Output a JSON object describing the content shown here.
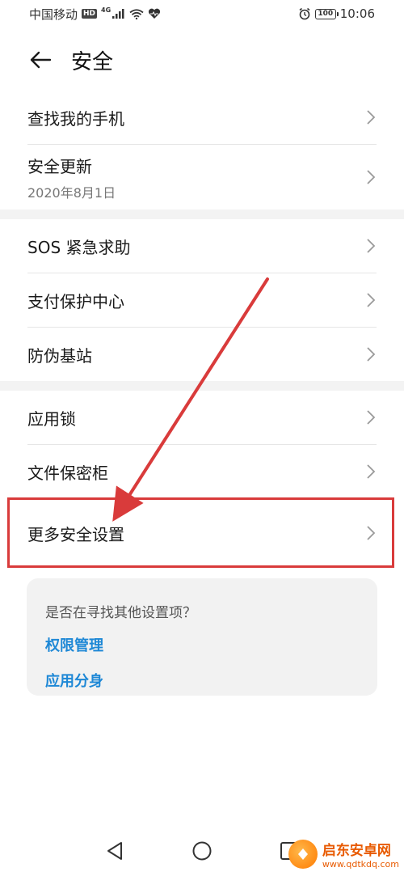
{
  "status_bar": {
    "carrier": "中国移动",
    "hd": "HD",
    "network": "4G",
    "battery": "100",
    "time": "10:06"
  },
  "header": {
    "title": "安全"
  },
  "groups": [
    {
      "items": [
        {
          "label": "查找我的手机",
          "sub": ""
        },
        {
          "label": "安全更新",
          "sub": "2020年8月1日"
        }
      ]
    },
    {
      "items": [
        {
          "label": "SOS 紧急求助",
          "sub": ""
        },
        {
          "label": "支付保护中心",
          "sub": ""
        },
        {
          "label": "防伪基站",
          "sub": ""
        }
      ]
    },
    {
      "items": [
        {
          "label": "应用锁",
          "sub": ""
        },
        {
          "label": "文件保密柜",
          "sub": ""
        },
        {
          "label": "更多安全设置",
          "sub": ""
        }
      ]
    }
  ],
  "suggestion_card": {
    "question": "是否在寻找其他设置项？",
    "links": [
      "权限管理",
      "应用分身"
    ]
  },
  "watermark": {
    "name": "启东安卓网",
    "url": "www.qdtkdq.com"
  },
  "colors": {
    "accent": "#1e88d6",
    "highlight": "#d93b3b",
    "band": "#f3f3f3"
  }
}
